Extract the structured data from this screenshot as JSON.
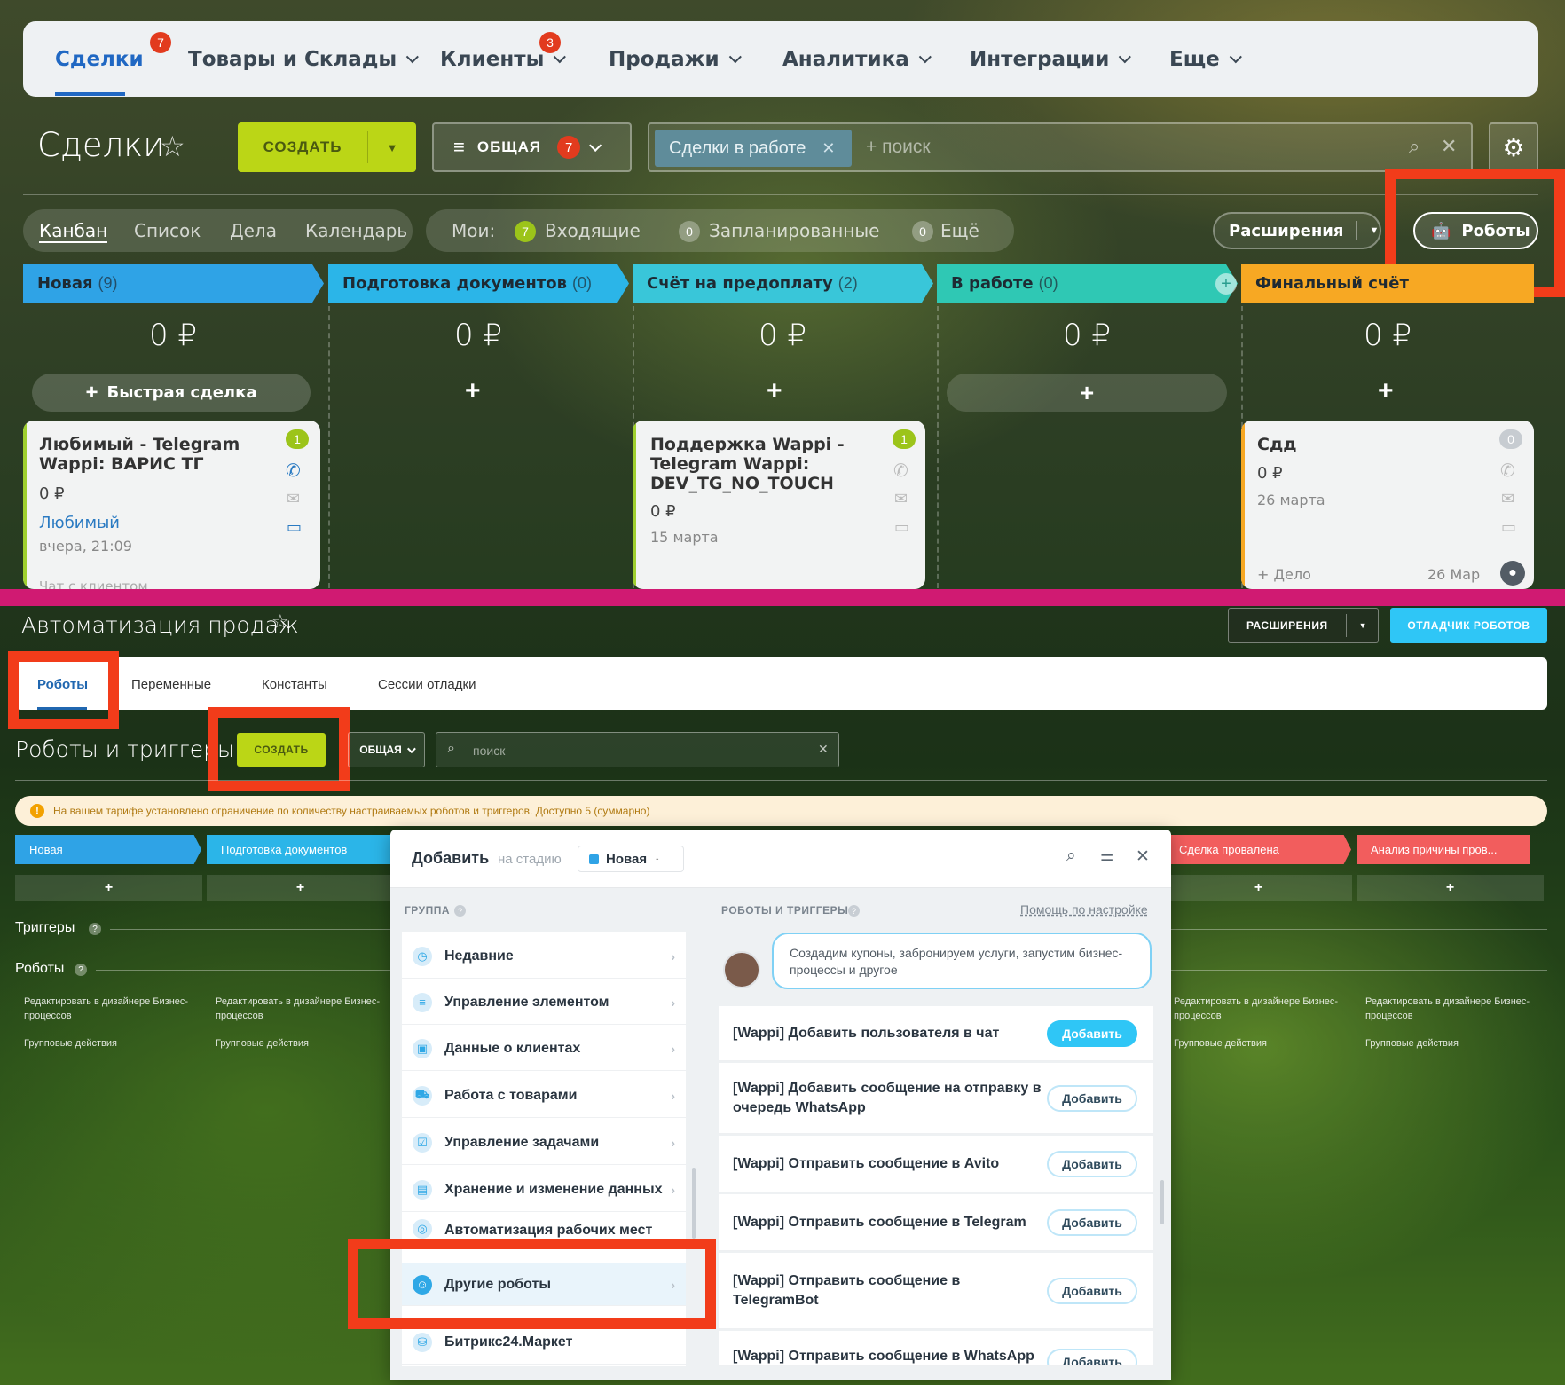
{
  "crm": {
    "nav": {
      "items": [
        {
          "label": "Сделки",
          "badge": "7"
        },
        {
          "label": "Товары и Склады"
        },
        {
          "label": "Клиенты",
          "badge": "3"
        },
        {
          "label": "Продажи"
        },
        {
          "label": "Аналитика"
        },
        {
          "label": "Интеграции"
        },
        {
          "label": "Еще"
        }
      ]
    },
    "title": "Сделки",
    "create_label": "СОЗДАТЬ",
    "filter": {
      "label": "ОБЩАЯ",
      "badge": "7"
    },
    "search": {
      "chip": "Сделки в работе",
      "placeholder": "+ поиск"
    },
    "views": [
      "Канбан",
      "Список",
      "Дела",
      "Календарь"
    ],
    "mine": {
      "label": "Мои:",
      "incoming_count": "7",
      "incoming": "Входящие",
      "planned_count": "0",
      "planned": "Запланированные",
      "more_count": "0",
      "more": "Ещё"
    },
    "extensions_label": "Расширения",
    "robots_label": "Роботы",
    "columns": [
      {
        "name": "Новая",
        "count": "(9)",
        "color": "#2fa3e6",
        "sum": "0 ₽"
      },
      {
        "name": "Подготовка документов",
        "count": "(0)",
        "color": "#2bb5e8",
        "sum": "0 ₽"
      },
      {
        "name": "Счёт на предоплату",
        "count": "(2)",
        "color": "#39c6d9",
        "sum": "0 ₽"
      },
      {
        "name": "В работе",
        "count": "(0)",
        "color": "#2fc8b4",
        "sum": "0 ₽"
      },
      {
        "name": "Финальный счёт",
        "count": "",
        "color": "#f7a823",
        "sum": "0 ₽"
      }
    ],
    "quick_deal": "Быстрая сделка",
    "cards": [
      {
        "title": "Любимый - Telegram Wappi: ВАРИС ТГ",
        "amount": "0 ₽",
        "client": "Любимый",
        "date": "вчера, 21:09",
        "counter": "1",
        "footer": "Чат с клиентом"
      },
      {
        "title": "Поддержка Wappi - Telegram Wappi: DEV_TG_NO_TOUCH",
        "amount": "0 ₽",
        "date": "15 марта",
        "counter": "1"
      },
      {
        "title": "Сдд",
        "amount": "0 ₽",
        "date": "26 марта",
        "counter": "0",
        "task": "+ Дело",
        "task_date": "26 Мар"
      }
    ]
  },
  "auto": {
    "title": "Автоматизация продаж",
    "extensions_label": "РАСШИРЕНИЯ",
    "debugger_label": "ОТЛАДЧИК РОБОТОВ",
    "tabs": [
      "Роботы",
      "Переменные",
      "Константы",
      "Сессии отладки"
    ],
    "subtitle": "Роботы и триггеры",
    "create_label": "СОЗДАТЬ",
    "filter_label": "ОБЩАЯ",
    "search_placeholder": "поиск",
    "warning": "На вашем тарифе установлено ограничение по количеству настраиваемых роботов и триггеров. Доступно 5 (суммарно)",
    "stages": [
      {
        "name": "Новая",
        "color": "#2fa3e6"
      },
      {
        "name": "Подготовка документов",
        "color": "#2bb5e8"
      },
      {
        "name": "Сделка провалена",
        "color": "#f25d5d"
      },
      {
        "name": "Анализ причины пров...",
        "color": "#f25d5d"
      }
    ],
    "triggers_label": "Триггеры",
    "robots_label": "Роботы",
    "edit_designer": "Редактировать в дизайнере Бизнес-процессов",
    "group_actions": "Групповые действия",
    "popup": {
      "title": "Добавить",
      "on_stage": "на стадию",
      "stage": "Новая",
      "group_header": "ГРУППА",
      "robots_header": "РОБОТЫ И ТРИГГЕРЫ",
      "help": "Помощь по настройке",
      "groups": [
        "Недавние",
        "Управление элементом",
        "Данные о клиентах",
        "Работа с товарами",
        "Управление задачами",
        "Хранение и изменение данных",
        "Автоматизация рабочих мест",
        "Другие роботы",
        "Битрикс24.Маркет"
      ],
      "hint": "Создадим купоны, забронируем услуги, запустим бизнес-процессы и другое",
      "add_label": "Добавить",
      "robots": [
        "[Wappi] Добавить пользователя в чат",
        "[Wappi] Добавить сообщение на отправку в очередь WhatsApp",
        "[Wappi] Отправить сообщение в Avito",
        "[Wappi] Отправить сообщение в Telegram",
        "[Wappi] Отправить сообщение в TelegramBot",
        "[Wappi] Отправить сообщение в WhatsApp"
      ]
    }
  },
  "colors": {
    "accent_green": "#bbd616",
    "highlight_red": "#f23c1a",
    "divider_pink": "#d01a72",
    "primary_blue": "#2fc6f6"
  }
}
